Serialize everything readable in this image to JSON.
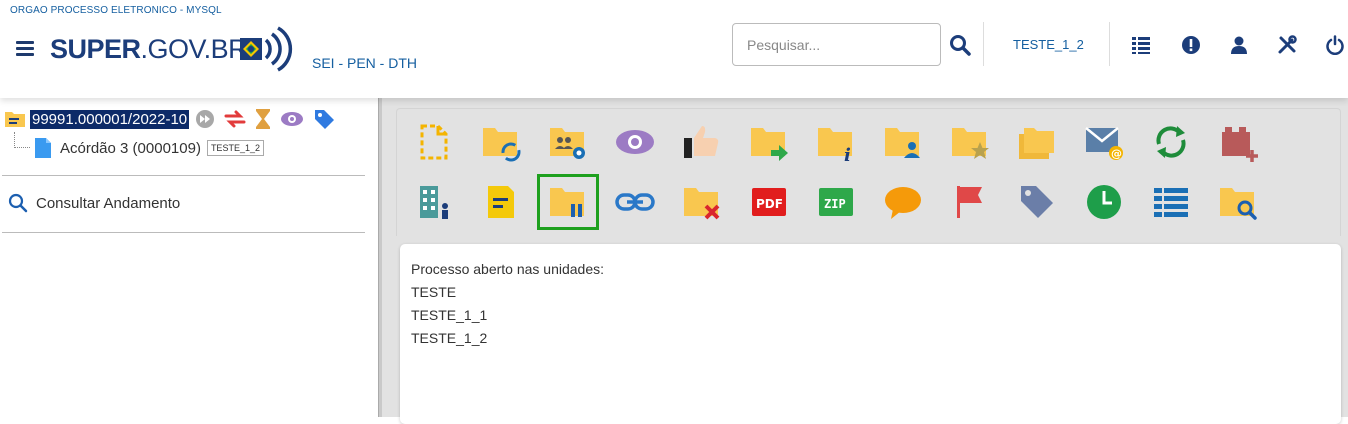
{
  "header": {
    "org_name": "ORGAO PROCESSO ELETRONICO - MYSQL",
    "logo_bold": "SUPER",
    "logo_rest": ".GOV.BR",
    "subtitle": "SEI - PEN - DTH",
    "search_placeholder": "Pesquisar...",
    "unit": "TESTE_1_2",
    "icons": [
      "list-icon",
      "alert-icon",
      "user-icon",
      "tools-icon",
      "power-icon"
    ]
  },
  "tree": {
    "process_number": "99991.000001/2022-10",
    "document_label": "Acórdão 3 (0000109)",
    "document_badge": "TESTE_1_2",
    "consult_label": "Consultar Andamento"
  },
  "toolbar": {
    "row1": [
      "new-document-icon",
      "folder-sync-icon",
      "folder-users-settings-icon",
      "eye-icon",
      "thumbs-up-icon",
      "folder-send-icon",
      "folder-info-icon",
      "folder-user-icon",
      "folder-star-icon",
      "folders-icon",
      "mail-at-icon",
      "sync-icon",
      "brick-plus-icon"
    ],
    "row2": [
      "building-user-icon",
      "note-icon",
      "folder-pause-icon",
      "link-icon",
      "folder-cancel-icon",
      "pdf-icon",
      "zip-icon",
      "comment-icon",
      "flag-icon",
      "tag-icon",
      "clock-icon",
      "list-view-icon",
      "folder-search-icon"
    ],
    "selected": "folder-pause-icon",
    "pdf_text": "PDF",
    "zip_text": "ZIP"
  },
  "info": {
    "lines": [
      "Processo aberto nas unidades:",
      "TESTE",
      "TESTE_1_1",
      "TESTE_1_2"
    ]
  },
  "colors": {
    "brand": "#1c3d7a",
    "link": "#155fa0",
    "folder": "#f9c74f",
    "selected_border": "#1ea01e"
  }
}
